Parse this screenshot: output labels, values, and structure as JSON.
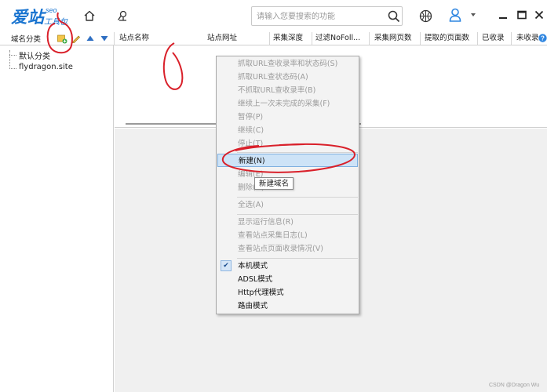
{
  "app": {
    "logo_main": "爱站",
    "logo_seo": "seo",
    "logo_sub": "工具包"
  },
  "header": {
    "search_placeholder": "请输入您要搜索的功能",
    "icons": [
      "home-icon",
      "location-settings-icon",
      "search-icon",
      "basketball-icon",
      "user-icon",
      "dropdown-arrow-icon",
      "minimize-icon",
      "maximize-icon",
      "close-icon"
    ]
  },
  "sidebar": {
    "header_label": "域名分类",
    "toolbar_icons": [
      "add-domain-icon",
      "edit-icon",
      "move-up-icon",
      "move-down-icon"
    ],
    "items": [
      {
        "label": "默认分类"
      },
      {
        "label": "flydragon.site"
      }
    ]
  },
  "table": {
    "columns": [
      "站点名称",
      "站点网址",
      "采集深度",
      "过滤NoFoll...",
      "采集网页数",
      "提取的页面数",
      "已收录",
      "未收录"
    ]
  },
  "context_menu": {
    "items": [
      {
        "label": "抓取URL查收录率和状态码(S)",
        "enabled": false
      },
      {
        "label": "抓取URL查状态码(A)",
        "enabled": false
      },
      {
        "label": "不抓取URL查收录率(B)",
        "enabled": false
      },
      {
        "label": "继续上一次未完成的采集(F)",
        "enabled": false
      },
      {
        "label": "暂停(P)",
        "enabled": false
      },
      {
        "label": "继续(C)",
        "enabled": false
      },
      {
        "label": "停止(T)",
        "enabled": false
      },
      {
        "label": "新建(N)",
        "enabled": true,
        "highlighted": true
      },
      {
        "label": "编辑(E)",
        "enabled": false
      },
      {
        "label": "删除(D)",
        "enabled": false
      },
      {
        "label": "全选(A)",
        "enabled": false
      },
      {
        "label": "显示运行信息(R)",
        "enabled": false
      },
      {
        "label": "查看站点采集日志(L)",
        "enabled": false
      },
      {
        "label": "查看站点页面收录情况(V)",
        "enabled": false
      },
      {
        "label": "本机模式",
        "enabled": true,
        "checked": true
      },
      {
        "label": "ADSL模式",
        "enabled": true
      },
      {
        "label": "Http代理模式",
        "enabled": true
      },
      {
        "label": "路由模式",
        "enabled": true
      }
    ]
  },
  "tooltip": {
    "text": "新建域名"
  },
  "watermark": "CSDN @Dragon     Wu",
  "colors": {
    "brand_blue": "#1b75d0",
    "annotation_red": "#d9202a",
    "menu_highlight": "#cde3f7",
    "disabled_text": "#9b9b9b"
  }
}
